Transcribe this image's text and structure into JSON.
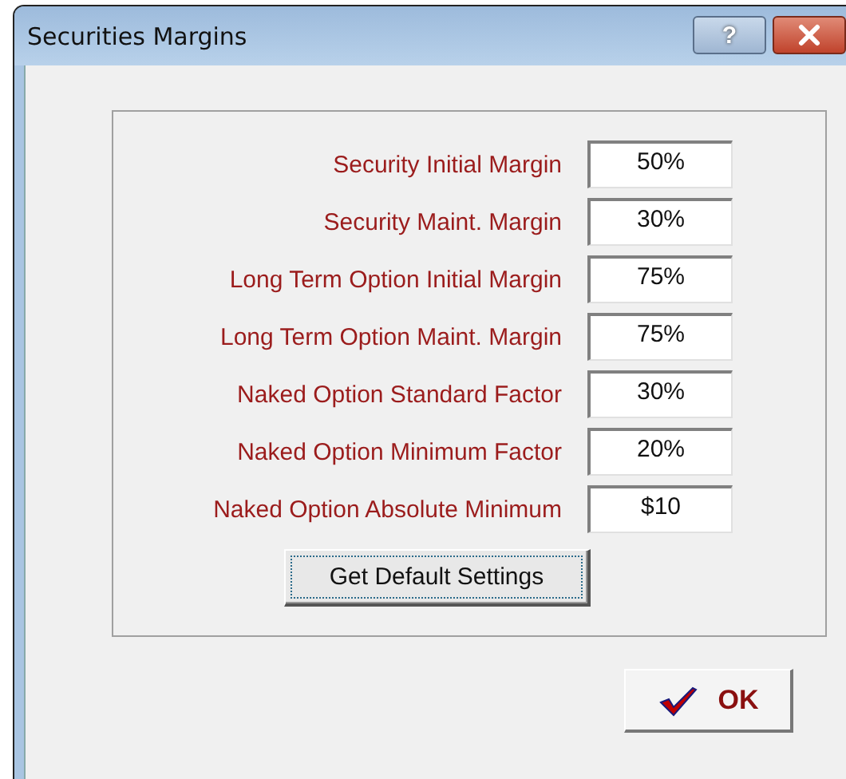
{
  "window": {
    "title": "Securities Margins"
  },
  "title_buttons": [
    {
      "kind": "help",
      "label": "?"
    },
    {
      "kind": "close"
    }
  ],
  "fields": [
    {
      "label": "Security Initial Margin",
      "value": "50%"
    },
    {
      "label": "Security Maint. Margin",
      "value": "30%"
    },
    {
      "label": "Long Term Option Initial Margin",
      "value": "75%"
    },
    {
      "label": "Long Term Option Maint. Margin",
      "value": "75%"
    },
    {
      "label": "Naked Option Standard Factor",
      "value": "30%"
    },
    {
      "label": "Naked Option Minimum Factor",
      "value": "20%"
    },
    {
      "label": "Naked Option Absolute Minimum",
      "value": "$10"
    }
  ],
  "default_button": {
    "label": "Get Default Settings",
    "focused": true
  },
  "ok_button": {
    "label": "OK"
  }
}
